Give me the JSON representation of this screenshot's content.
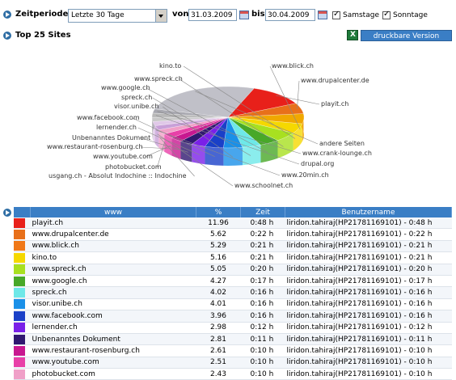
{
  "filters": {
    "period_label": "Zeitperiode:",
    "period_value": "Letzte 30 Tage",
    "from_label": "von",
    "from_date": "31.03.2009",
    "to_label": "bis",
    "to_date": "30.04.2009",
    "saturday_label": "Samstage",
    "sunday_label": "Sonntage",
    "saturday_checked": true,
    "sunday_checked": true
  },
  "section": {
    "title": "Top 25 Sites",
    "print_button": "druckbare Version",
    "excel_icon": "excel-icon"
  },
  "chart_data": {
    "type": "pie",
    "labels": [
      "playit.ch",
      "www.drupalcenter.de",
      "www.blick.ch",
      "kino.to",
      "www.spreck.ch",
      "www.google.ch",
      "spreck.ch",
      "visor.unibe.ch",
      "www.facebook.com",
      "lernender.ch",
      "Unbenanntes Dokument",
      "www.restaurant-rosenburg.ch",
      "www.youtube.com",
      "photobucket.com",
      "usgang.ch - Absolut Indochine :: Indochine",
      "www.schoolnet.ch",
      "www.20min.ch",
      "drupal.org",
      "www.crank-lounge.ch",
      "andere Seiten"
    ],
    "colors": [
      "#e8201a",
      "#e8701a",
      "#f0a800",
      "#f5d800",
      "#a8e020",
      "#48a828",
      "#6ee8e8",
      "#1a90e8",
      "#1a40c8",
      "#7a20e8",
      "#301870",
      "#c81890",
      "#e840a8",
      "#f0a0c8",
      "#c8a0d8",
      "#e0c8e8",
      "#c8c8c8",
      "#b8b8b8",
      "#a8a8b0",
      "#c0c0c8"
    ]
  },
  "table": {
    "headers": [
      "www",
      "%",
      "Zeit",
      "Benutzername"
    ],
    "rows": [
      {
        "color": "#e8201a",
        "www": "playit.ch",
        "pct": "11.96",
        "time": "0:48 h",
        "user": "liridon.tahiraj(HP217811691​01) - 0:48 h"
      },
      {
        "color": "#e8701a",
        "www": "www.drupalcenter.de",
        "pct": "5.62",
        "time": "0:22 h",
        "user": "liridon.tahiraj(HP21781169101) - 0:22 h"
      },
      {
        "color": "#f07818",
        "www": "www.blick.ch",
        "pct": "5.29",
        "time": "0:21 h",
        "user": "liridon.tahiraj(HP21781169101) - 0:21 h"
      },
      {
        "color": "#f5d800",
        "www": "kino.to",
        "pct": "5.16",
        "time": "0:21 h",
        "user": "liridon.tahiraj(HP21781169101) - 0:21 h"
      },
      {
        "color": "#a8e020",
        "www": "www.spreck.ch",
        "pct": "5.05",
        "time": "0:20 h",
        "user": "liridon.tahiraj(HP21781169101) - 0:20 h"
      },
      {
        "color": "#48a828",
        "www": "www.google.ch",
        "pct": "4.27",
        "time": "0:17 h",
        "user": "liridon.tahiraj(HP21781169101) - 0:17 h"
      },
      {
        "color": "#6ee8e8",
        "www": "spreck.ch",
        "pct": "4.02",
        "time": "0:16 h",
        "user": "liridon.tahiraj(HP21781169101) - 0:16 h"
      },
      {
        "color": "#1a90e8",
        "www": "visor.unibe.ch",
        "pct": "4.01",
        "time": "0:16 h",
        "user": "liridon.tahiraj(HP21781169101) - 0:16 h"
      },
      {
        "color": "#1a40c8",
        "www": "www.facebook.com",
        "pct": "3.96",
        "time": "0:16 h",
        "user": "liridon.tahiraj(HP21781169101) - 0:16 h"
      },
      {
        "color": "#7a20e8",
        "www": "lernender.ch",
        "pct": "2.98",
        "time": "0:12 h",
        "user": "liridon.tahiraj(HP21781169101) - 0:12 h"
      },
      {
        "color": "#301870",
        "www": "Unbenanntes Dokument",
        "pct": "2.81",
        "time": "0:11 h",
        "user": "liridon.tahiraj(HP21781169101) - 0:11 h"
      },
      {
        "color": "#c81890",
        "www": "www.restaurant-rosenburg.ch",
        "pct": "2.61",
        "time": "0:10 h",
        "user": "liridon.tahiraj(HP21781169101) - 0:10 h"
      },
      {
        "color": "#e840a8",
        "www": "www.youtube.com",
        "pct": "2.51",
        "time": "0:10 h",
        "user": "liridon.tahiraj(HP21781169101) - 0:10 h"
      },
      {
        "color": "#f0a0c8",
        "www": "photobucket.com",
        "pct": "2.43",
        "time": "0:10 h",
        "user": "liridon.tahiraj(HP21781169101) - 0:10 h"
      }
    ]
  }
}
